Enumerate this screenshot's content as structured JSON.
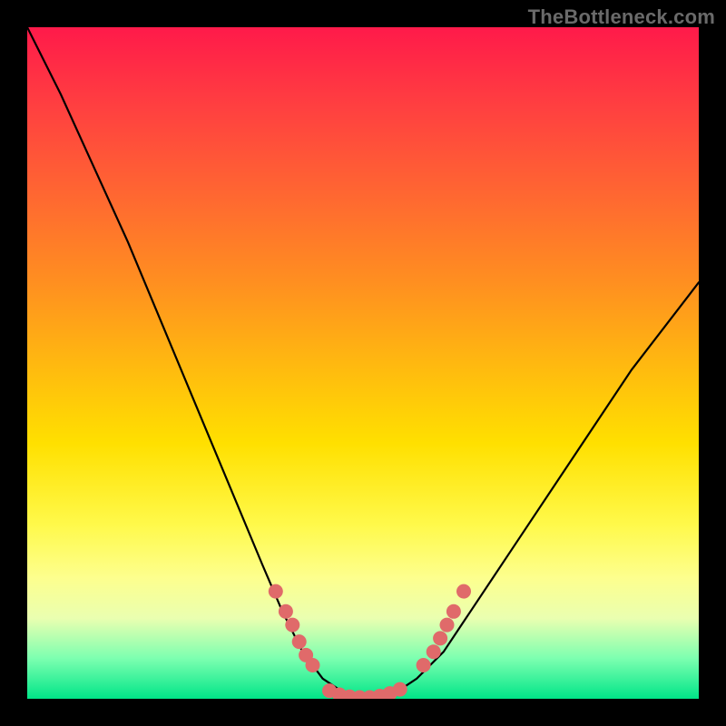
{
  "watermark": "TheBottleneck.com",
  "colors": {
    "dot": "#e06a6a",
    "curve": "#000000",
    "frame": "#000000"
  },
  "chart_data": {
    "type": "line",
    "title": "",
    "xlabel": "",
    "ylabel": "",
    "xlim": [
      0,
      100
    ],
    "ylim": [
      0,
      100
    ],
    "grid": false,
    "legend": false,
    "series": [
      {
        "name": "bottleneck-curve",
        "x": [
          0,
          5,
          10,
          15,
          20,
          25,
          30,
          35,
          38,
          41,
          44,
          47,
          49,
          51,
          53,
          55,
          58,
          62,
          66,
          72,
          80,
          90,
          100
        ],
        "y": [
          100,
          90,
          79,
          68,
          56,
          44,
          32,
          20,
          13,
          7,
          3,
          1,
          0,
          0,
          0,
          1,
          3,
          7,
          13,
          22,
          34,
          49,
          62
        ]
      }
    ],
    "points": [
      {
        "name": "left-cluster",
        "x": [
          37,
          38.5,
          39.5,
          40.5,
          41.5,
          42.5
        ],
        "y": [
          16,
          13,
          11,
          8.5,
          6.5,
          5
        ]
      },
      {
        "name": "bottom-cluster",
        "x": [
          45,
          46.5,
          48,
          49.5,
          51,
          52.5,
          54,
          55.5
        ],
        "y": [
          1.2,
          0.6,
          0.3,
          0.2,
          0.2,
          0.4,
          0.8,
          1.4
        ]
      },
      {
        "name": "right-cluster",
        "x": [
          59,
          60.5,
          61.5,
          62.5,
          63.5,
          65
        ],
        "y": [
          5,
          7,
          9,
          11,
          13,
          16
        ]
      }
    ]
  }
}
